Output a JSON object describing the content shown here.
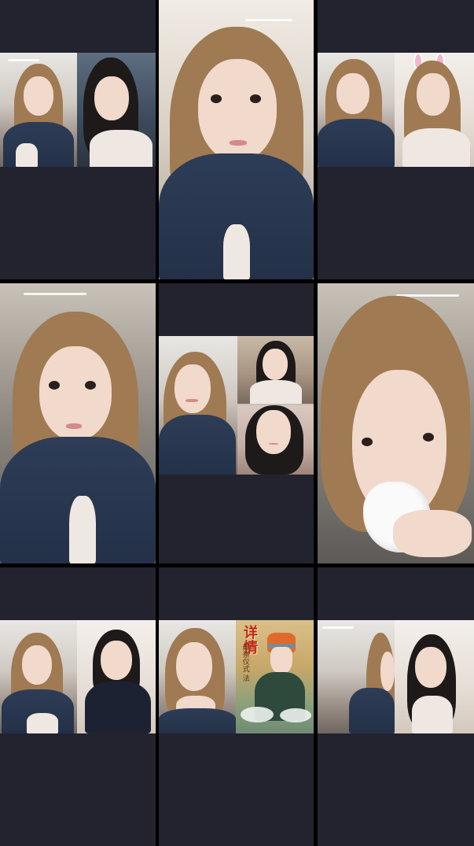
{
  "app": {
    "screen_type": "live-stream multi-guest grid"
  },
  "colors": {
    "tile_background": "#23232f",
    "grid_gap": "#000000",
    "denim": "#2e3d57",
    "light_hair": "#a07a52",
    "dark_hair": "#1e1a1a"
  },
  "tiles": [
    {
      "id": "t1",
      "kind": "split-duo",
      "icon": "video-feed"
    },
    {
      "id": "t2",
      "kind": "single-fill",
      "icon": "video-feed"
    },
    {
      "id": "t3",
      "kind": "split-duo",
      "icon": "video-feed"
    },
    {
      "id": "t4",
      "kind": "single-fill",
      "icon": "video-feed"
    },
    {
      "id": "t5",
      "kind": "trio",
      "icon": "video-feed"
    },
    {
      "id": "t6",
      "kind": "single-fill",
      "icon": "video-feed"
    },
    {
      "id": "t7",
      "kind": "split-duo",
      "icon": "video-feed"
    },
    {
      "id": "t8",
      "kind": "split-duo-anime",
      "icon": "video-feed"
    },
    {
      "id": "t9",
      "kind": "split-duo",
      "icon": "video-feed"
    }
  ],
  "anime_poster": {
    "title": "详情",
    "subtitle": "献祭仪式 法"
  }
}
